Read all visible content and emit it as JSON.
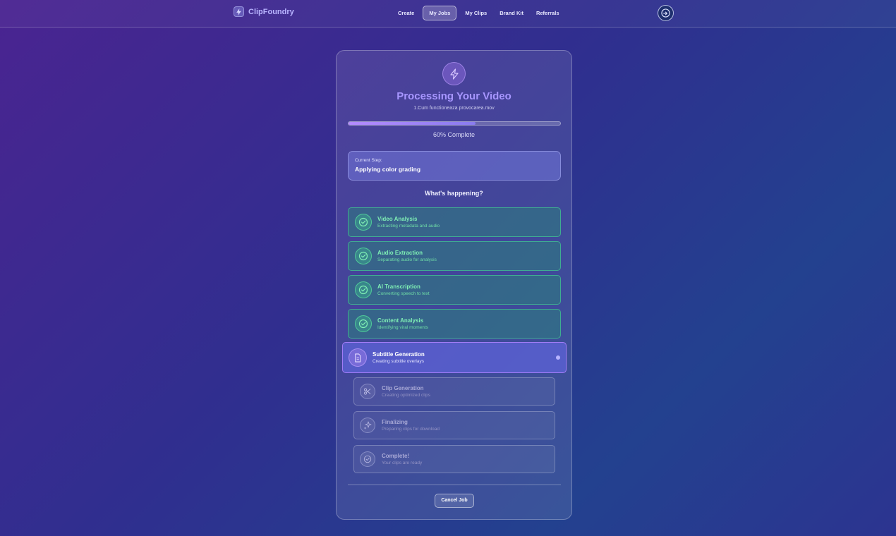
{
  "app": {
    "brand": "ClipFoundry"
  },
  "nav": {
    "items": [
      "Create",
      "My Jobs",
      "My Clips",
      "Brand Kit",
      "Referrals"
    ],
    "active": "My Jobs"
  },
  "header": {
    "avatar_icon": "user-avatar-icon"
  },
  "processing": {
    "title": "Processing Your Video",
    "filename": "1.Cum functioneaza provocarea.mov",
    "progress_percent": 60,
    "progress_text": "60% Complete",
    "current_step_label": "Current Step:",
    "current_step_value": "Applying color grading",
    "section_heading": "What's happening?",
    "steps": [
      {
        "title": "Video Analysis",
        "desc": "Extracting metadata and audio",
        "status": "done",
        "icon": "check-circle-icon"
      },
      {
        "title": "Audio Extraction",
        "desc": "Separating audio for analysis",
        "status": "done",
        "icon": "check-circle-icon"
      },
      {
        "title": "AI Transcription",
        "desc": "Converting speech to text",
        "status": "done",
        "icon": "check-circle-icon"
      },
      {
        "title": "Content Analysis",
        "desc": "Identifying viral moments",
        "status": "done",
        "icon": "check-circle-icon"
      },
      {
        "title": "Subtitle Generation",
        "desc": "Creating subtitle overlays",
        "status": "active",
        "icon": "document-icon"
      },
      {
        "title": "Clip Generation",
        "desc": "Creating optimized clips",
        "status": "pending",
        "icon": "scissors-icon"
      },
      {
        "title": "Finalizing",
        "desc": "Preparing clips for download",
        "status": "pending",
        "icon": "sparkles-icon"
      },
      {
        "title": "Complete!",
        "desc": "Your clips are ready",
        "status": "pending",
        "icon": "check-circle-icon"
      }
    ],
    "cancel_label": "Cancel Job"
  },
  "colors": {
    "accent": "#a796ff",
    "done": "#7ff0b5",
    "active_border": "#af82ff"
  }
}
